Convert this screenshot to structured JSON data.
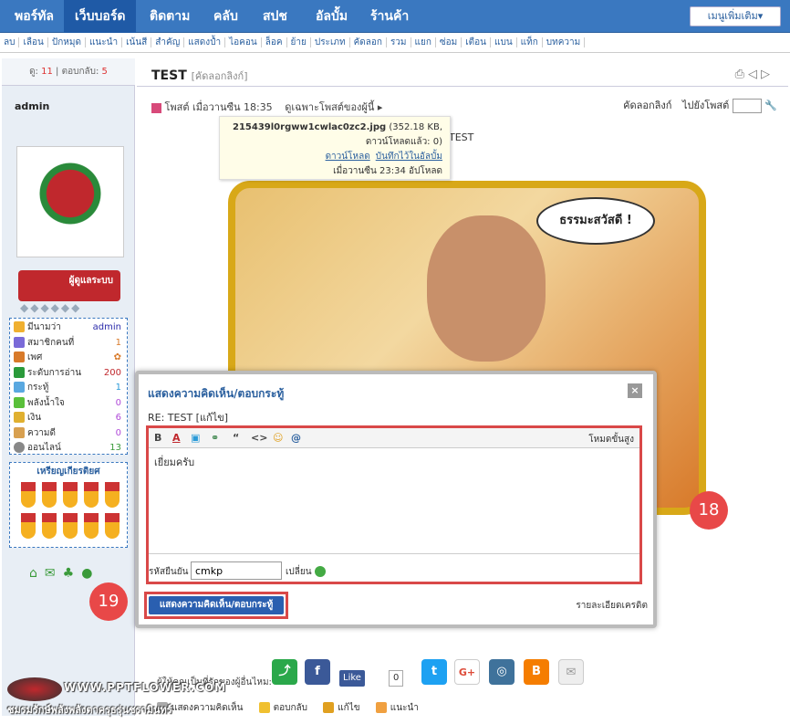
{
  "topnav": {
    "items": [
      "พอร์ทัล",
      "เว็บบอร์ด",
      "ติดตาม",
      "คลับ",
      "สปช",
      "อัลบั้ม",
      "ร้านค้า"
    ],
    "active_index": 1,
    "more_label": "เมนูเพิ่มเติม▾"
  },
  "subnav": {
    "items": [
      "ลบ",
      "เลือน",
      "ปักหมุด",
      "แนะนำ",
      "เน้นสี",
      "สำคัญ",
      "แสดงป้ำ",
      "ไอคอน",
      "ล็อค",
      "ย้าย",
      "ประเภท",
      "คัดลอก",
      "รวม",
      "แยก",
      "ซ่อม",
      "เตือน",
      "แบน",
      "แท็ก",
      "บทความ"
    ]
  },
  "sidebar": {
    "stats_label_views": "ดู:",
    "stats_views": "11",
    "stats_label_replies": "ตอบกลับ:",
    "stats_replies": "5",
    "username": "admin",
    "rank_label": "ผู้ดูแลระบบ",
    "info_rows": [
      {
        "label": "มีนามว่า",
        "value": "admin",
        "color": "#2a2aaa"
      },
      {
        "label": "สมาชิกคนที่",
        "value": "1",
        "color": "#d87a2a"
      },
      {
        "label": "เพศ",
        "value": "",
        "color": "#d87a2a"
      },
      {
        "label": "ระดับการอ่าน",
        "value": "200",
        "color": "#c0282d"
      },
      {
        "label": "กระทู้",
        "value": "1",
        "color": "#2a9ad8"
      },
      {
        "label": "พลังน้ำใจ",
        "value": "0",
        "color": "#b04ad8"
      },
      {
        "label": "เงิน",
        "value": "6",
        "color": "#b04ad8"
      },
      {
        "label": "ความดี",
        "value": "0",
        "color": "#b04ad8"
      },
      {
        "label": "ออนไลน์",
        "value": "13",
        "color": "#3a9a3a"
      }
    ],
    "medals_title": "เหรียญเกียรติยศ"
  },
  "post": {
    "title": "TEST",
    "copy_link": "[คัดลอกลิงก์]",
    "meta": "โพสต์ เมื่อวานซืน 18:35",
    "meta_extra": "ดูเฉพาะโพสต์ของผู้นี้ ▸",
    "copy_label": "คัดลอกลิงก์",
    "goto_label": "ไปยังโพสต์",
    "body_text": "TEST",
    "bubble_text": "ธรรมะสวัสดี !"
  },
  "attachment_tooltip": {
    "filename": "215439l0rgww1cwlac0zc2.jpg",
    "size": "(352.18 KB,",
    "downloads": "ดาวน์โหลดแล้ว: 0)",
    "download_link": "ดาวน์โหลด",
    "save_link": "บันทึกไว้ในอัลบั้ม",
    "uploaded": "เมื่อวานซืน 23:34 อัปโหลด"
  },
  "dialog": {
    "title": "แสดงความคิดเห็น/ตอบกระทู้",
    "subject": "RE: TEST [แก้ไข]",
    "toolbar_mode": "โหมดขั้นสูง",
    "editor_text": "เยี่ยมครับ",
    "captcha_label": "รหัสยืนยัน",
    "captcha_value": "cmkp",
    "captcha_change": "เปลี่ยน",
    "submit_label": "แสดงความคิดเห็น/ตอบกระทู้",
    "credit_link": "รายละเอียดเครดิต"
  },
  "badges": {
    "editor": "18",
    "submit": "19"
  },
  "share": {
    "label": "ผู้ให้คุณเป็นที่รักของผู้อื่นไหม:",
    "like_label": "Like",
    "like_count": "0"
  },
  "footer_actions": [
    "แสดงความคิดเห็น",
    "ตอบกลับ",
    "แก้ไข",
    "แนะนำ"
  ],
  "watermark": {
    "site": "WWW.PPTFLOWER.COM",
    "thai": "ชมรมรักษ์พลังพลังตาครุธรุ่นชรามินทร์"
  },
  "colors": {
    "nav_bg": "#3a78c0",
    "accent_red": "#d94848",
    "sidebar_bg": "#e8eef5"
  }
}
